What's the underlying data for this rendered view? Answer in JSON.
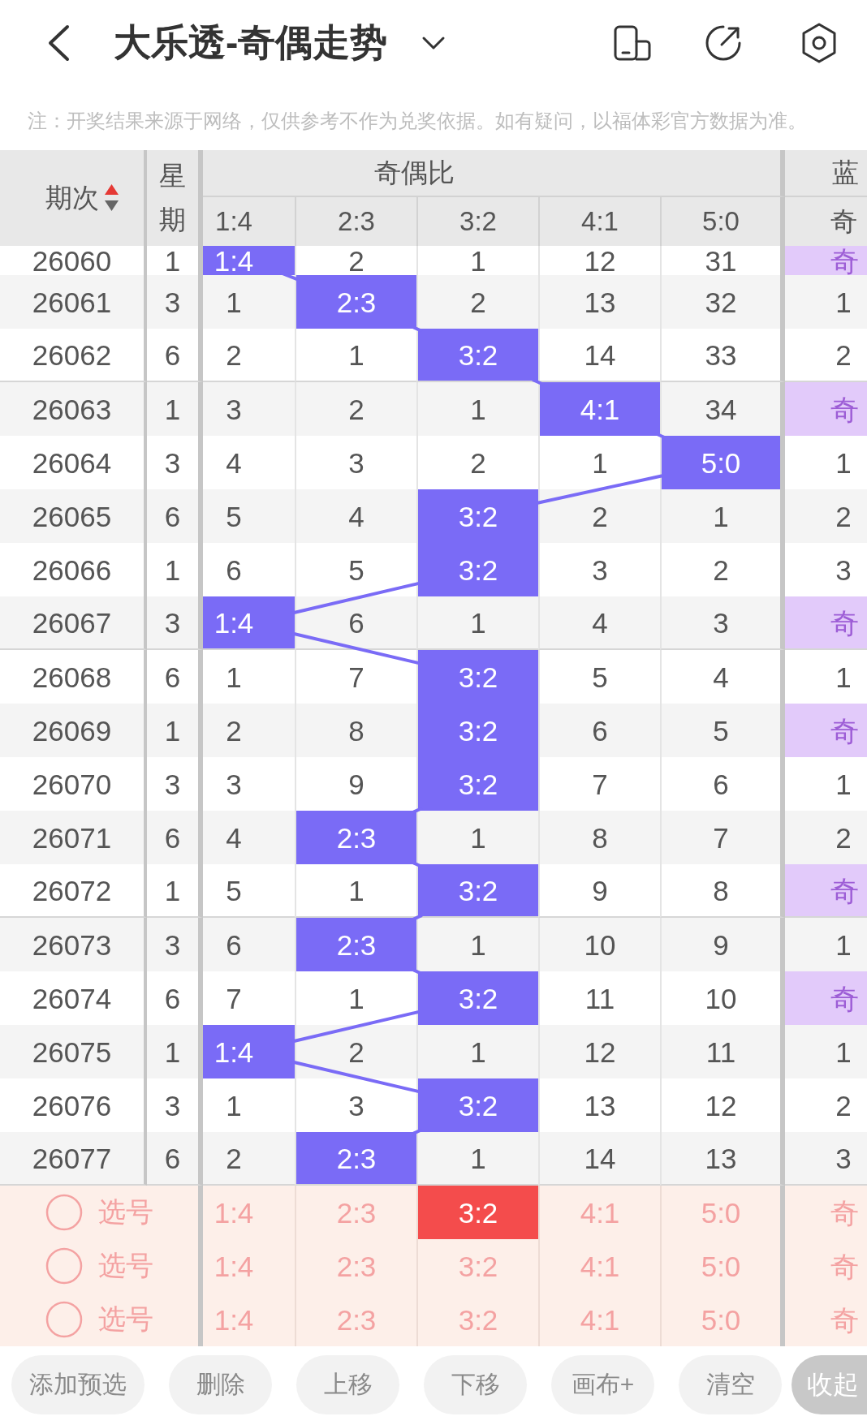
{
  "header": {
    "title": "大乐透-奇偶走势"
  },
  "notice": {
    "text": "注：开奖结果来源于网络，仅供参考不作为兑奖依据。如有疑问，以福体彩官方数据为准。"
  },
  "table": {
    "columns": {
      "period": "期次",
      "weekday": "星期",
      "ratio_group": "奇偶比",
      "ratios": [
        "1:4",
        "2:3",
        "3:2",
        "4:1",
        "5:0"
      ],
      "blue_group": "蓝",
      "blue_sub": "奇"
    },
    "sort_ascending": true,
    "rows": [
      {
        "period": "26060",
        "weekday": "1",
        "cells": [
          {
            "text": "1:4",
            "hit": true
          },
          {
            "text": "2",
            "hit": false
          },
          {
            "text": "1",
            "hit": false
          },
          {
            "text": "12",
            "hit": false
          },
          {
            "text": "31",
            "hit": false
          }
        ],
        "blue": {
          "text": "奇",
          "hit": true
        }
      },
      {
        "period": "26061",
        "weekday": "3",
        "cells": [
          {
            "text": "1",
            "hit": false
          },
          {
            "text": "2:3",
            "hit": true
          },
          {
            "text": "2",
            "hit": false
          },
          {
            "text": "13",
            "hit": false
          },
          {
            "text": "32",
            "hit": false
          }
        ],
        "blue": {
          "text": "1",
          "hit": false
        }
      },
      {
        "period": "26062",
        "weekday": "6",
        "cells": [
          {
            "text": "2",
            "hit": false
          },
          {
            "text": "1",
            "hit": false
          },
          {
            "text": "3:2",
            "hit": true
          },
          {
            "text": "14",
            "hit": false
          },
          {
            "text": "33",
            "hit": false
          }
        ],
        "blue": {
          "text": "2",
          "hit": false
        }
      },
      {
        "period": "26063",
        "weekday": "1",
        "cells": [
          {
            "text": "3",
            "hit": false
          },
          {
            "text": "2",
            "hit": false
          },
          {
            "text": "1",
            "hit": false
          },
          {
            "text": "4:1",
            "hit": true
          },
          {
            "text": "34",
            "hit": false
          }
        ],
        "blue": {
          "text": "奇",
          "hit": true
        }
      },
      {
        "period": "26064",
        "weekday": "3",
        "cells": [
          {
            "text": "4",
            "hit": false
          },
          {
            "text": "3",
            "hit": false
          },
          {
            "text": "2",
            "hit": false
          },
          {
            "text": "1",
            "hit": false
          },
          {
            "text": "5:0",
            "hit": true
          }
        ],
        "blue": {
          "text": "1",
          "hit": false
        }
      },
      {
        "period": "26065",
        "weekday": "6",
        "cells": [
          {
            "text": "5",
            "hit": false
          },
          {
            "text": "4",
            "hit": false
          },
          {
            "text": "3:2",
            "hit": true
          },
          {
            "text": "2",
            "hit": false
          },
          {
            "text": "1",
            "hit": false
          }
        ],
        "blue": {
          "text": "2",
          "hit": false
        }
      },
      {
        "period": "26066",
        "weekday": "1",
        "cells": [
          {
            "text": "6",
            "hit": false
          },
          {
            "text": "5",
            "hit": false
          },
          {
            "text": "3:2",
            "hit": true
          },
          {
            "text": "3",
            "hit": false
          },
          {
            "text": "2",
            "hit": false
          }
        ],
        "blue": {
          "text": "3",
          "hit": false
        }
      },
      {
        "period": "26067",
        "weekday": "3",
        "cells": [
          {
            "text": "1:4",
            "hit": true
          },
          {
            "text": "6",
            "hit": false
          },
          {
            "text": "1",
            "hit": false
          },
          {
            "text": "4",
            "hit": false
          },
          {
            "text": "3",
            "hit": false
          }
        ],
        "blue": {
          "text": "奇",
          "hit": true
        }
      },
      {
        "period": "26068",
        "weekday": "6",
        "cells": [
          {
            "text": "1",
            "hit": false
          },
          {
            "text": "7",
            "hit": false
          },
          {
            "text": "3:2",
            "hit": true
          },
          {
            "text": "5",
            "hit": false
          },
          {
            "text": "4",
            "hit": false
          }
        ],
        "blue": {
          "text": "1",
          "hit": false
        }
      },
      {
        "period": "26069",
        "weekday": "1",
        "cells": [
          {
            "text": "2",
            "hit": false
          },
          {
            "text": "8",
            "hit": false
          },
          {
            "text": "3:2",
            "hit": true
          },
          {
            "text": "6",
            "hit": false
          },
          {
            "text": "5",
            "hit": false
          }
        ],
        "blue": {
          "text": "奇",
          "hit": true
        }
      },
      {
        "period": "26070",
        "weekday": "3",
        "cells": [
          {
            "text": "3",
            "hit": false
          },
          {
            "text": "9",
            "hit": false
          },
          {
            "text": "3:2",
            "hit": true
          },
          {
            "text": "7",
            "hit": false
          },
          {
            "text": "6",
            "hit": false
          }
        ],
        "blue": {
          "text": "1",
          "hit": false
        }
      },
      {
        "period": "26071",
        "weekday": "6",
        "cells": [
          {
            "text": "4",
            "hit": false
          },
          {
            "text": "2:3",
            "hit": true
          },
          {
            "text": "1",
            "hit": false
          },
          {
            "text": "8",
            "hit": false
          },
          {
            "text": "7",
            "hit": false
          }
        ],
        "blue": {
          "text": "2",
          "hit": false
        }
      },
      {
        "period": "26072",
        "weekday": "1",
        "cells": [
          {
            "text": "5",
            "hit": false
          },
          {
            "text": "1",
            "hit": false
          },
          {
            "text": "3:2",
            "hit": true
          },
          {
            "text": "9",
            "hit": false
          },
          {
            "text": "8",
            "hit": false
          }
        ],
        "blue": {
          "text": "奇",
          "hit": true
        }
      },
      {
        "period": "26073",
        "weekday": "3",
        "cells": [
          {
            "text": "6",
            "hit": false
          },
          {
            "text": "2:3",
            "hit": true
          },
          {
            "text": "1",
            "hit": false
          },
          {
            "text": "10",
            "hit": false
          },
          {
            "text": "9",
            "hit": false
          }
        ],
        "blue": {
          "text": "1",
          "hit": false
        }
      },
      {
        "period": "26074",
        "weekday": "6",
        "cells": [
          {
            "text": "7",
            "hit": false
          },
          {
            "text": "1",
            "hit": false
          },
          {
            "text": "3:2",
            "hit": true
          },
          {
            "text": "11",
            "hit": false
          },
          {
            "text": "10",
            "hit": false
          }
        ],
        "blue": {
          "text": "奇",
          "hit": true
        }
      },
      {
        "period": "26075",
        "weekday": "1",
        "cells": [
          {
            "text": "1:4",
            "hit": true
          },
          {
            "text": "2",
            "hit": false
          },
          {
            "text": "1",
            "hit": false
          },
          {
            "text": "12",
            "hit": false
          },
          {
            "text": "11",
            "hit": false
          }
        ],
        "blue": {
          "text": "1",
          "hit": false
        }
      },
      {
        "period": "26076",
        "weekday": "3",
        "cells": [
          {
            "text": "1",
            "hit": false
          },
          {
            "text": "3",
            "hit": false
          },
          {
            "text": "3:2",
            "hit": true
          },
          {
            "text": "13",
            "hit": false
          },
          {
            "text": "12",
            "hit": false
          }
        ],
        "blue": {
          "text": "2",
          "hit": false
        }
      },
      {
        "period": "26077",
        "weekday": "6",
        "cells": [
          {
            "text": "2",
            "hit": false
          },
          {
            "text": "2:3",
            "hit": true
          },
          {
            "text": "1",
            "hit": false
          },
          {
            "text": "14",
            "hit": false
          },
          {
            "text": "13",
            "hit": false
          }
        ],
        "blue": {
          "text": "3",
          "hit": false
        }
      }
    ]
  },
  "picks": [
    {
      "checked": false,
      "label": "选号",
      "options": [
        {
          "text": "1:4",
          "selected": false
        },
        {
          "text": "2:3",
          "selected": false
        },
        {
          "text": "3:2",
          "selected": true
        },
        {
          "text": "4:1",
          "selected": false
        },
        {
          "text": "5:0",
          "selected": false
        },
        {
          "text": "奇",
          "selected": false
        }
      ]
    },
    {
      "checked": false,
      "label": "选号",
      "options": [
        {
          "text": "1:4",
          "selected": false
        },
        {
          "text": "2:3",
          "selected": false
        },
        {
          "text": "3:2",
          "selected": false
        },
        {
          "text": "4:1",
          "selected": false
        },
        {
          "text": "5:0",
          "selected": false
        },
        {
          "text": "奇",
          "selected": false
        }
      ]
    },
    {
      "checked": false,
      "label": "选号",
      "options": [
        {
          "text": "1:4",
          "selected": false
        },
        {
          "text": "2:3",
          "selected": false
        },
        {
          "text": "3:2",
          "selected": false
        },
        {
          "text": "4:1",
          "selected": false
        },
        {
          "text": "5:0",
          "selected": false
        },
        {
          "text": "奇",
          "selected": false
        }
      ]
    }
  ],
  "actions": [
    {
      "label": "添加预选",
      "kind": "pill"
    },
    {
      "label": "删除",
      "kind": "pill"
    },
    {
      "label": "上移",
      "kind": "pill"
    },
    {
      "label": "下移",
      "kind": "pill"
    },
    {
      "label": "画布+",
      "kind": "pill"
    },
    {
      "label": "清空",
      "kind": "pill"
    },
    {
      "label": "收起",
      "kind": "solid"
    }
  ]
}
